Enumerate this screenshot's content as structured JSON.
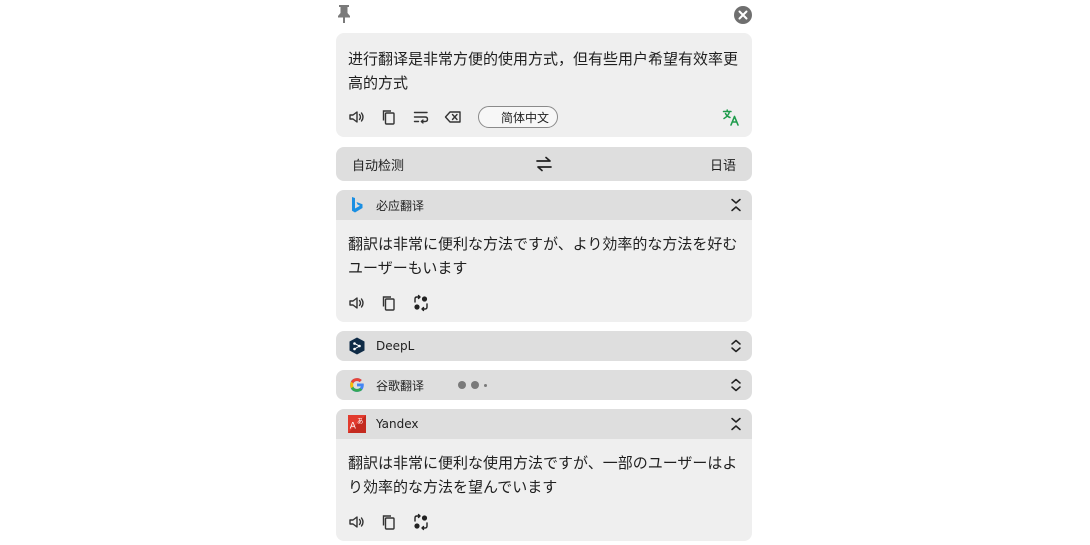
{
  "window": {
    "pin_icon": "pin-icon",
    "close_icon": "close-icon"
  },
  "source": {
    "text": "进行翻译是非常方便的使用方式，但有些用户希望有效率更高的方式",
    "language_pill": "简体中文",
    "toolbar_icons": [
      "speaker-icon",
      "copy-icon",
      "wrap-icon",
      "clear-icon"
    ],
    "translate_icon": "translate-icon"
  },
  "language_bar": {
    "from": "自动检测",
    "swap_icon": "swap-icon",
    "to": "日语"
  },
  "services": [
    {
      "name": "必应翻译",
      "logo": "bing-logo",
      "expanded": true,
      "text": "翻訳は非常に便利な方法ですが、より効率的な方法を好むユーザーもいます",
      "toolbar_icons": [
        "speaker-icon",
        "copy-icon",
        "retranslate-icon"
      ]
    },
    {
      "name": "DeepL",
      "logo": "deepl-logo",
      "expanded": false
    },
    {
      "name": "谷歌翻译",
      "logo": "google-logo",
      "expanded": false,
      "loading": true
    },
    {
      "name": "Yandex",
      "logo": "yandex-logo",
      "expanded": true,
      "text": "翻訳は非常に便利な使用方法ですが、一部のユーザーはより効率的な方法を望んでいます",
      "toolbar_icons": [
        "speaker-icon",
        "copy-icon",
        "retranslate-icon"
      ]
    }
  ],
  "colors": {
    "card_bg": "#efefef",
    "header_bg": "#dedede",
    "translate_green": "#1e9b4b",
    "bing_blue": "#1a8fe3",
    "deepl_navy": "#0f2b46",
    "yandex_red": "#e23b2e"
  }
}
